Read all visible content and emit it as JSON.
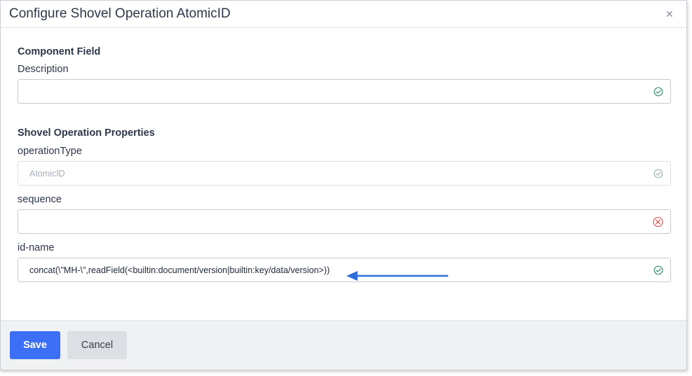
{
  "dialog": {
    "title": "Configure Shovel Operation AtomicID",
    "close_glyph": "✕"
  },
  "component_section": {
    "title": "Component Field",
    "description": {
      "label": "Description",
      "value": "",
      "status": "valid"
    }
  },
  "properties_section": {
    "title": "Shovel Operation Properties",
    "operation_type": {
      "label": "operationType",
      "value": "AtomicID",
      "status": "valid",
      "disabled": true
    },
    "sequence": {
      "label": "sequence",
      "value": "",
      "status": "invalid"
    },
    "id_name": {
      "label": "id-name",
      "value": "concat(\\\"MH-\\\",readField(<builtin:document/version|builtin:key/data/version>))",
      "status": "valid"
    }
  },
  "footer": {
    "save_label": "Save",
    "cancel_label": "Cancel"
  },
  "colors": {
    "primary": "#3b6ff5",
    "valid": "#3a8f74",
    "invalid": "#d9534f",
    "arrow": "#2f6fdc"
  },
  "icons": {
    "valid": "check-circle-icon",
    "invalid": "x-circle-icon",
    "close": "close-icon"
  }
}
